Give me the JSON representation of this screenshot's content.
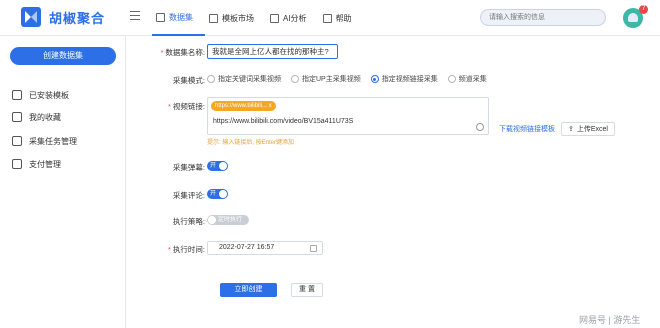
{
  "header": {
    "logo_text": "胡椒聚合",
    "nav": [
      {
        "label": "数据集",
        "icon": "dataset-icon",
        "active": true
      },
      {
        "label": "模板市场",
        "icon": "template-icon",
        "active": false
      },
      {
        "label": "AI分析",
        "icon": "ai-icon",
        "active": false
      },
      {
        "label": "帮助",
        "icon": "help-icon",
        "active": false
      }
    ],
    "search_placeholder": "请输入搜索的信息",
    "notification_count": "7"
  },
  "sidebar": {
    "create_label": "创建数据集",
    "items": [
      {
        "label": "已安装模板",
        "icon": "installed-template-icon"
      },
      {
        "label": "我的收藏",
        "icon": "favorites-icon"
      },
      {
        "label": "采集任务管理",
        "icon": "task-icon"
      },
      {
        "label": "支付管理",
        "icon": "payment-icon"
      }
    ]
  },
  "form": {
    "dataset_name_label": "数据集名称:",
    "dataset_name_value": "我就是全网上亿人都在找的那种主?",
    "collect_mode_label": "采集模式:",
    "collect_modes": [
      {
        "label": "指定关键词采集视频",
        "checked": false
      },
      {
        "label": "指定UP主采集视频",
        "checked": false
      },
      {
        "label": "指定视频链接采集",
        "checked": true
      },
      {
        "label": "频道采集",
        "checked": false
      }
    ],
    "video_link_label": "视频链接:",
    "video_tag": "https://www.bilibili... x",
    "video_url": "https://www.bilibili.com/video/BV15a411U73S",
    "hint": "提示: 输入链接后, 按Enter键添加",
    "template_link": "下载视频链接模板",
    "upload_label": "上传Excel",
    "danmaku_label": "采集弹幕:",
    "danmaku_toggle": "开",
    "comment_label": "采集评论:",
    "comment_toggle": "开",
    "strategy_label": "执行策略:",
    "strategy_toggle": "定时执行",
    "time_label": "执行时间:",
    "time_value": "2022-07-27 16:57",
    "submit_label": "立即创建",
    "reset_label": "重 置"
  },
  "watermark": "网易号 | 游先生",
  "colors": {
    "accent": "#2d6fe6",
    "tag": "#f5a623",
    "hint": "#e6a23c"
  }
}
